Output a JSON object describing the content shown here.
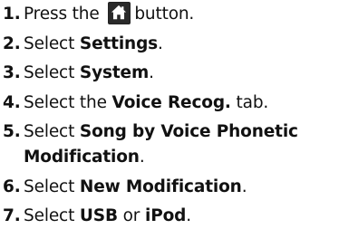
{
  "steps": [
    {
      "num": "1.",
      "pre": "Press the ",
      "bold": "",
      "post": "button.",
      "icon": "home-icon"
    },
    {
      "num": "2.",
      "pre": "Select ",
      "bold": "Settings",
      "post": "."
    },
    {
      "num": "3.",
      "pre": "Select ",
      "bold": "System",
      "post": "."
    },
    {
      "num": "4.",
      "pre": "Select the ",
      "bold": "Voice Recog.",
      "post": " tab."
    },
    {
      "num": "5.",
      "pre": "Select ",
      "bold": "Song by Voice Phonetic Modification",
      "post": "."
    },
    {
      "num": "6.",
      "pre": "Select ",
      "bold": "New Modification",
      "post": "."
    },
    {
      "num": "7.",
      "pre": "Select ",
      "bold": "USB",
      "mid": " or ",
      "bold2": "iPod",
      "post": "."
    }
  ]
}
